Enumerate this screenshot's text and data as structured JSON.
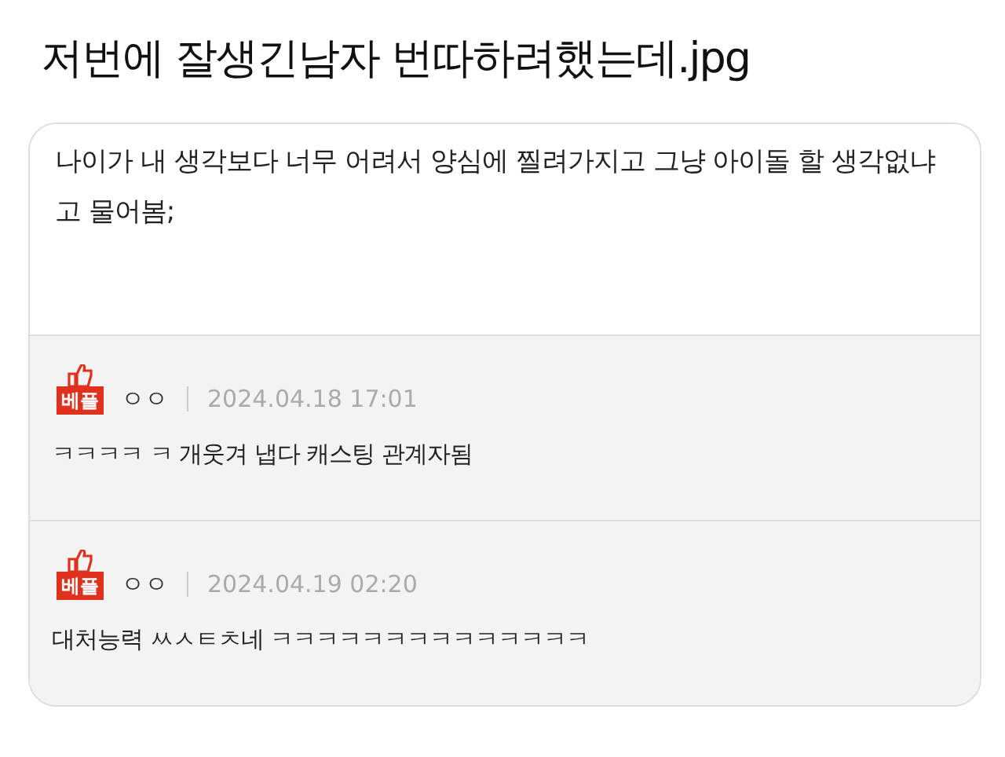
{
  "title": "저번에 잘생긴남자 번따하려했는데.jpg",
  "post": {
    "body": "나이가 내 생각보다 너무 어려서 양심에 찔려가지고 그냥 아이돌 할 생각없냐고 물어봄;"
  },
  "comments": [
    {
      "badge": "베플",
      "author": "ㅇㅇ",
      "date": "2024.04.18 17:01",
      "text": "ㅋㅋㅋㅋ ㅋ 개웃겨 냅다 캐스팅 관계자됨"
    },
    {
      "badge": "베플",
      "author": "ㅇㅇ",
      "date": "2024.04.19 02:20",
      "text": "대처능력 ㅆㅅㅌㅊ네 ㅋㅋㅋㅋㅋㅋㅋㅋㅋㅋㅋㅋㅋㅋ"
    }
  ]
}
